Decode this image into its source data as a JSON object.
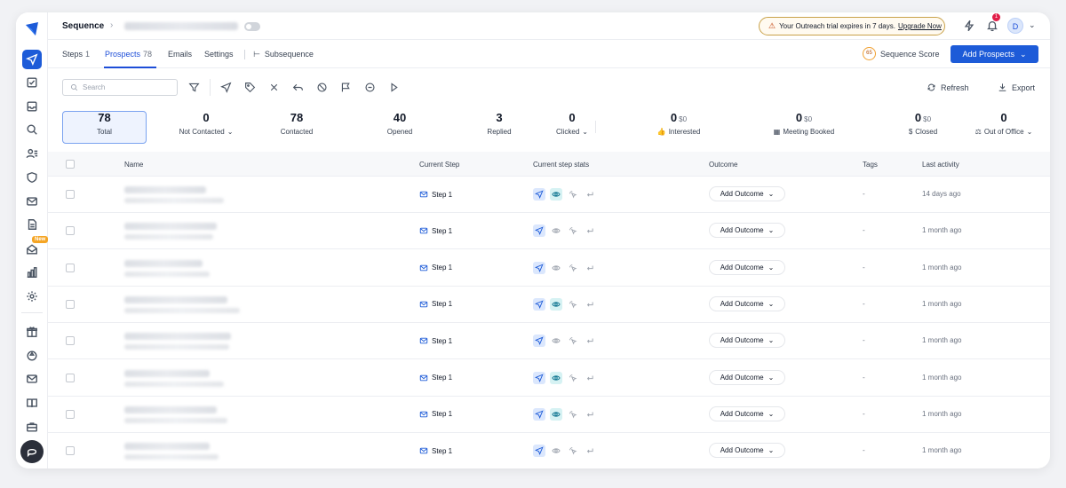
{
  "header": {
    "title": "Sequence",
    "trial_text": "Your Outreach trial expires in 7 days.",
    "upgrade_label": "Upgrade Now",
    "notification_count": "1",
    "avatar_initial": "D"
  },
  "sidebar": {
    "new_badge": "New",
    "items": [
      "send-icon",
      "checklist-icon",
      "inbox-icon",
      "search-icon",
      "contacts-icon",
      "shield-icon",
      "mail-icon",
      "document-icon",
      "mail-open-icon",
      "bar-chart-icon",
      "settings-icon",
      "gift-icon",
      "recycle-icon",
      "mail-check-icon",
      "book-icon",
      "briefcase-icon"
    ]
  },
  "tabs": [
    {
      "label": "Steps",
      "count": "1"
    },
    {
      "label": "Prospects",
      "count": "78"
    },
    {
      "label": "Emails",
      "count": ""
    },
    {
      "label": "Settings",
      "count": ""
    },
    {
      "label": "Subsequence",
      "count": ""
    }
  ],
  "sequence_score": {
    "value": "65",
    "label": "Sequence Score"
  },
  "add_prospects_label": "Add Prospects",
  "toolbar": {
    "search_placeholder": "Search",
    "refresh_label": "Refresh",
    "export_label": "Export"
  },
  "stats": [
    {
      "value": "78",
      "label": "Total",
      "money": ""
    },
    {
      "value": "0",
      "label": "Not Contacted",
      "money": ""
    },
    {
      "value": "78",
      "label": "Contacted",
      "money": ""
    },
    {
      "value": "40",
      "label": "Opened",
      "money": ""
    },
    {
      "value": "3",
      "label": "Replied",
      "money": ""
    },
    {
      "value": "0",
      "label": "Clicked",
      "money": ""
    },
    {
      "value": "0",
      "label": "Interested",
      "money": "$0"
    },
    {
      "value": "0",
      "label": "Meeting Booked",
      "money": "$0"
    },
    {
      "value": "0",
      "label": "Closed",
      "money": "$0"
    },
    {
      "value": "0",
      "label": "Out of Office",
      "money": ""
    }
  ],
  "table": {
    "columns": [
      "Name",
      "Current Step",
      "Current step stats",
      "Outcome",
      "Tags",
      "Last activity"
    ],
    "rows": [
      {
        "step": "Step 1",
        "opened": true,
        "outcome": "Add Outcome",
        "tags": "-",
        "last_activity": "14 days ago"
      },
      {
        "step": "Step 1",
        "opened": false,
        "outcome": "Add Outcome",
        "tags": "-",
        "last_activity": "1 month ago"
      },
      {
        "step": "Step 1",
        "opened": false,
        "outcome": "Add Outcome",
        "tags": "-",
        "last_activity": "1 month ago"
      },
      {
        "step": "Step 1",
        "opened": true,
        "outcome": "Add Outcome",
        "tags": "-",
        "last_activity": "1 month ago"
      },
      {
        "step": "Step 1",
        "opened": false,
        "outcome": "Add Outcome",
        "tags": "-",
        "last_activity": "1 month ago"
      },
      {
        "step": "Step 1",
        "opened": true,
        "outcome": "Add Outcome",
        "tags": "-",
        "last_activity": "1 month ago"
      },
      {
        "step": "Step 1",
        "opened": true,
        "outcome": "Add Outcome",
        "tags": "-",
        "last_activity": "1 month ago"
      },
      {
        "step": "Step 1",
        "opened": false,
        "outcome": "Add Outcome",
        "tags": "-",
        "last_activity": "1 month ago"
      }
    ]
  },
  "colors": {
    "brand": "#1d5bd8",
    "opened": "#0e7490",
    "badge": "#e11d48"
  }
}
